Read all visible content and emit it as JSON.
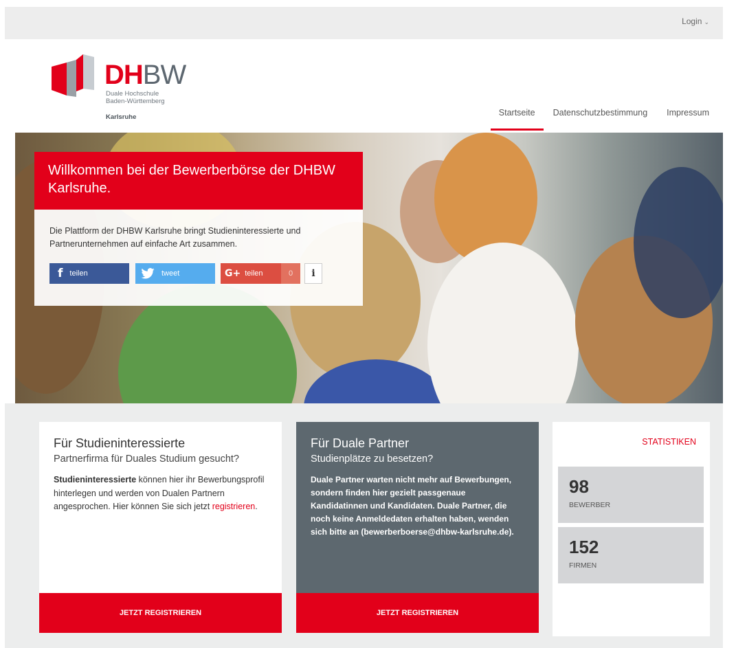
{
  "topbar": {
    "login_label": "Login"
  },
  "logo": {
    "dh": "DH",
    "bw": "BW",
    "subtitle_line1": "Duale Hochschule",
    "subtitle_line2": "Baden-Württemberg",
    "city": "Karlsruhe"
  },
  "nav": {
    "items": [
      {
        "label": "Startseite",
        "active": true
      },
      {
        "label": "Datenschutzbestimmung",
        "active": false
      },
      {
        "label": "Impressum",
        "active": false
      }
    ]
  },
  "hero": {
    "title": "Willkommen bei der Bewerberbörse der DHBW Karlsruhe.",
    "intro": "Die Plattform der DHBW Karlsruhe bringt Studieninteressierte und Partnerunternehmen auf einfache Art zusammen.",
    "share": {
      "facebook_label": "teilen",
      "twitter_label": "tweet",
      "google_label": "teilen",
      "google_count": "0",
      "info_label": "i"
    }
  },
  "cards": {
    "students": {
      "title": "Für Studieninteressierte",
      "subtitle": "Partnerfirma für Duales Studium gesucht?",
      "text_bold": "Studieninteressierte",
      "text_rest": " können hier ihr Bewerbungsprofil hinterlegen und werden von Dualen Partnern angesprochen. Hier können Sie sich jetzt ",
      "link": "registrieren",
      "text_end": ".",
      "cta": "JETZT REGISTRIEREN"
    },
    "partners": {
      "title": "Für Duale Partner",
      "subtitle": "Studienplätze zu besetzen?",
      "text": "Duale Partner warten nicht mehr auf Bewerbungen, sondern finden hier gezielt passgenaue Kandidatinnen und Kandidaten. Duale Partner, die noch keine Anmeldedaten erhalten haben, wenden sich bitte an (bewerberboerse@dhbw-karlsruhe.de).",
      "cta": "JETZT REGISTRIEREN"
    },
    "stats": {
      "title": "STATISTIKEN",
      "items": [
        {
          "value": "98",
          "label": "BEWERBER"
        },
        {
          "value": "152",
          "label": "FIRMEN"
        }
      ]
    }
  },
  "colors": {
    "accent": "#e2001a",
    "partner_card": "#5d686f",
    "facebook": "#3b5998",
    "twitter": "#55acee",
    "google": "#dc4e41"
  },
  "icons": [
    "chevron-down-icon",
    "dhbw-logo-mark",
    "facebook-icon",
    "twitter-icon",
    "google-plus-icon",
    "info-icon"
  ]
}
